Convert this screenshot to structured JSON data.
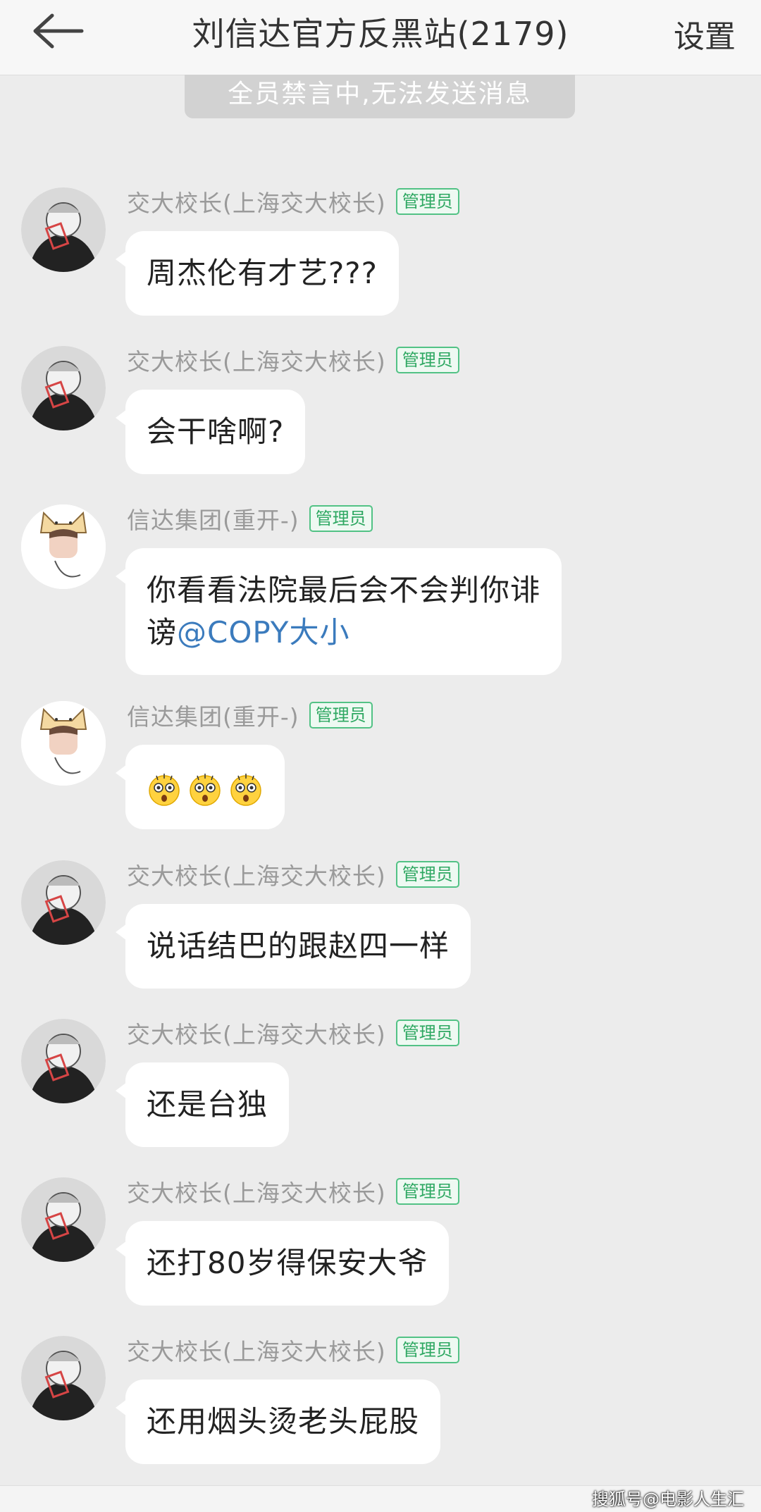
{
  "header": {
    "title": "刘信达官方反黑站(2179)",
    "settings_label": "设置",
    "back_icon": "back-arrow-icon"
  },
  "mute_banner": "全员禁言中,无法发送消息",
  "admin_badge": "管理员",
  "messages": [
    {
      "sender": "交大校长(上海交大校长)",
      "badge": "管理员",
      "text": "周杰伦有才艺???",
      "avatar": "elder-portrait"
    },
    {
      "sender": "交大校长(上海交大校长)",
      "badge": "管理员",
      "text": "会干啥啊?",
      "avatar": "elder-portrait"
    },
    {
      "sender": "信达集团(重开-)",
      "badge": "管理员",
      "text_line1": "你看看法院最后会不会判你诽",
      "text_line2": "谤",
      "mention": "@COPY大小",
      "avatar": "cat-hat-boy"
    },
    {
      "sender": "信达集团(重开-)",
      "badge": "管理员",
      "emoji": [
        "astonished-face",
        "astonished-face",
        "astonished-face"
      ],
      "avatar": "cat-hat-boy"
    },
    {
      "sender": "交大校长(上海交大校长)",
      "badge": "管理员",
      "text": "说话结巴的跟赵四一样",
      "avatar": "elder-portrait"
    },
    {
      "sender": "交大校长(上海交大校长)",
      "badge": "管理员",
      "text": "还是台独",
      "avatar": "elder-portrait"
    },
    {
      "sender": "交大校长(上海交大校长)",
      "badge": "管理员",
      "text": "还打80岁得保安大爷",
      "avatar": "elder-portrait"
    },
    {
      "sender": "交大校长(上海交大校长)",
      "badge": "管理员",
      "text": "还用烟头烫老头屁股",
      "avatar": "elder-portrait"
    }
  ],
  "watermark": "搜狐号@电影人生汇"
}
